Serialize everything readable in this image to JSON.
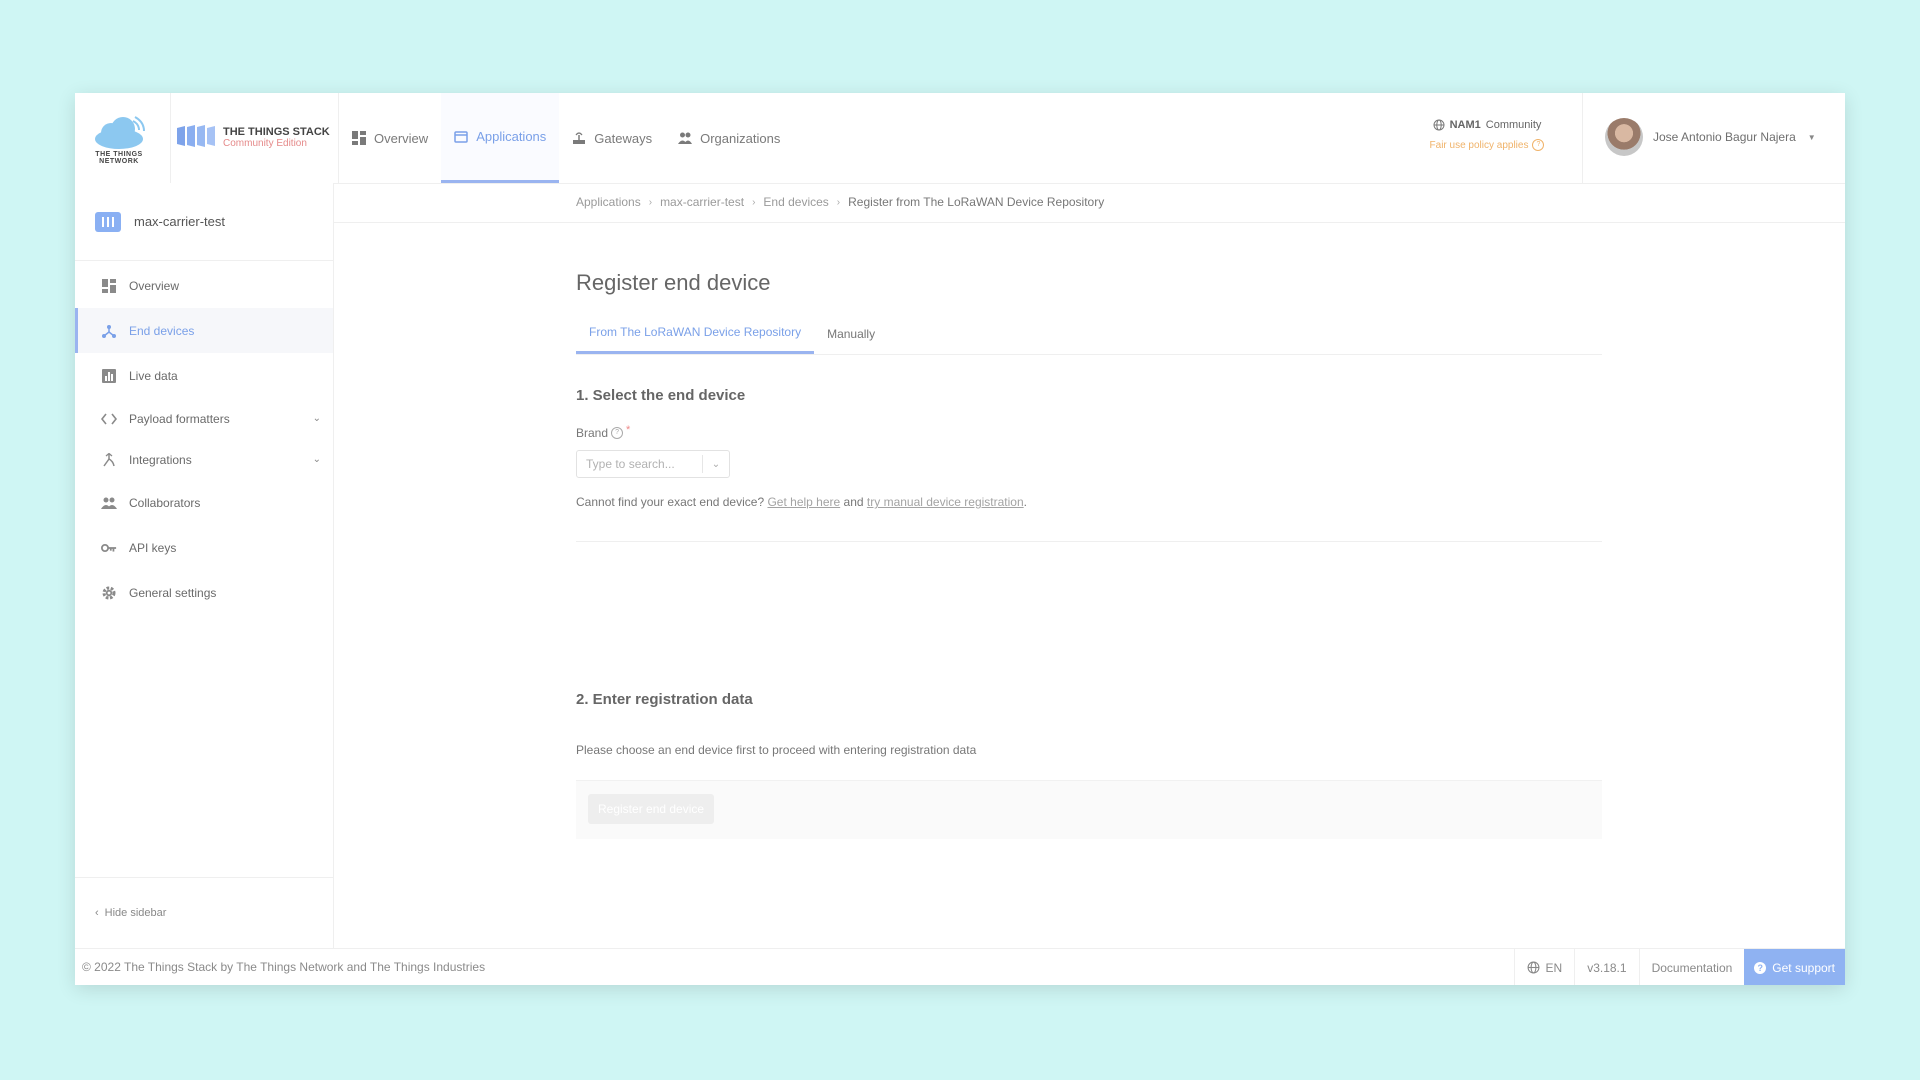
{
  "header": {
    "ttn_logo_text": "THE THINGS NETWORK",
    "stack_logo_title": "THE THINGS STACK",
    "stack_logo_subtitle": "Community Edition",
    "nav": [
      {
        "label": "Overview",
        "icon": "dashboard-icon"
      },
      {
        "label": "Applications",
        "icon": "application-icon",
        "active": true
      },
      {
        "label": "Gateways",
        "icon": "gateway-icon"
      },
      {
        "label": "Organizations",
        "icon": "organizations-icon"
      }
    ],
    "cluster": {
      "name": "NAM1",
      "tier": "Community",
      "policy": "Fair use policy applies"
    },
    "user": {
      "name": "Jose Antonio Bagur Najera"
    }
  },
  "sidebar": {
    "app_name": "max-carrier-test",
    "items": [
      {
        "label": "Overview",
        "icon": "dashboard-icon"
      },
      {
        "label": "End devices",
        "icon": "end-devices-icon",
        "active": true
      },
      {
        "label": "Live data",
        "icon": "live-data-icon"
      },
      {
        "label": "Payload formatters",
        "icon": "code-icon",
        "expandable": true
      },
      {
        "label": "Integrations",
        "icon": "integrations-icon",
        "expandable": true
      },
      {
        "label": "Collaborators",
        "icon": "collaborators-icon"
      },
      {
        "label": "API keys",
        "icon": "key-icon"
      },
      {
        "label": "General settings",
        "icon": "gear-icon"
      }
    ],
    "hide_label": "Hide sidebar"
  },
  "breadcrumb": [
    "Applications",
    "max-carrier-test",
    "End devices",
    "Register from The LoRaWAN Device Repository"
  ],
  "main": {
    "title": "Register end device",
    "tabs": [
      {
        "label": "From The LoRaWAN Device Repository",
        "active": true
      },
      {
        "label": "Manually"
      }
    ],
    "section1": "1. Select the end device",
    "brand_label": "Brand",
    "brand_required": "*",
    "brand_placeholder": "Type to search...",
    "help_prefix": "Cannot find your exact end device?",
    "help_link1": "Get help here",
    "help_and": "and",
    "help_link2": "try manual device registration",
    "help_suffix": ".",
    "section2": "2. Enter registration data",
    "registration_note": "Please choose an end device first to proceed with entering registration data",
    "submit_label": "Register end device"
  },
  "footer": {
    "copyright": "© 2022 The Things Stack by The Things Network and The Things Industries",
    "language": "EN",
    "version": "v3.18.1",
    "documentation": "Documentation",
    "support": "Get support"
  },
  "colors": {
    "background": "#cff6f4",
    "accent": "#7aa0e8",
    "support_button": "#8fb2f2",
    "policy_warning": "#f0b36a"
  }
}
